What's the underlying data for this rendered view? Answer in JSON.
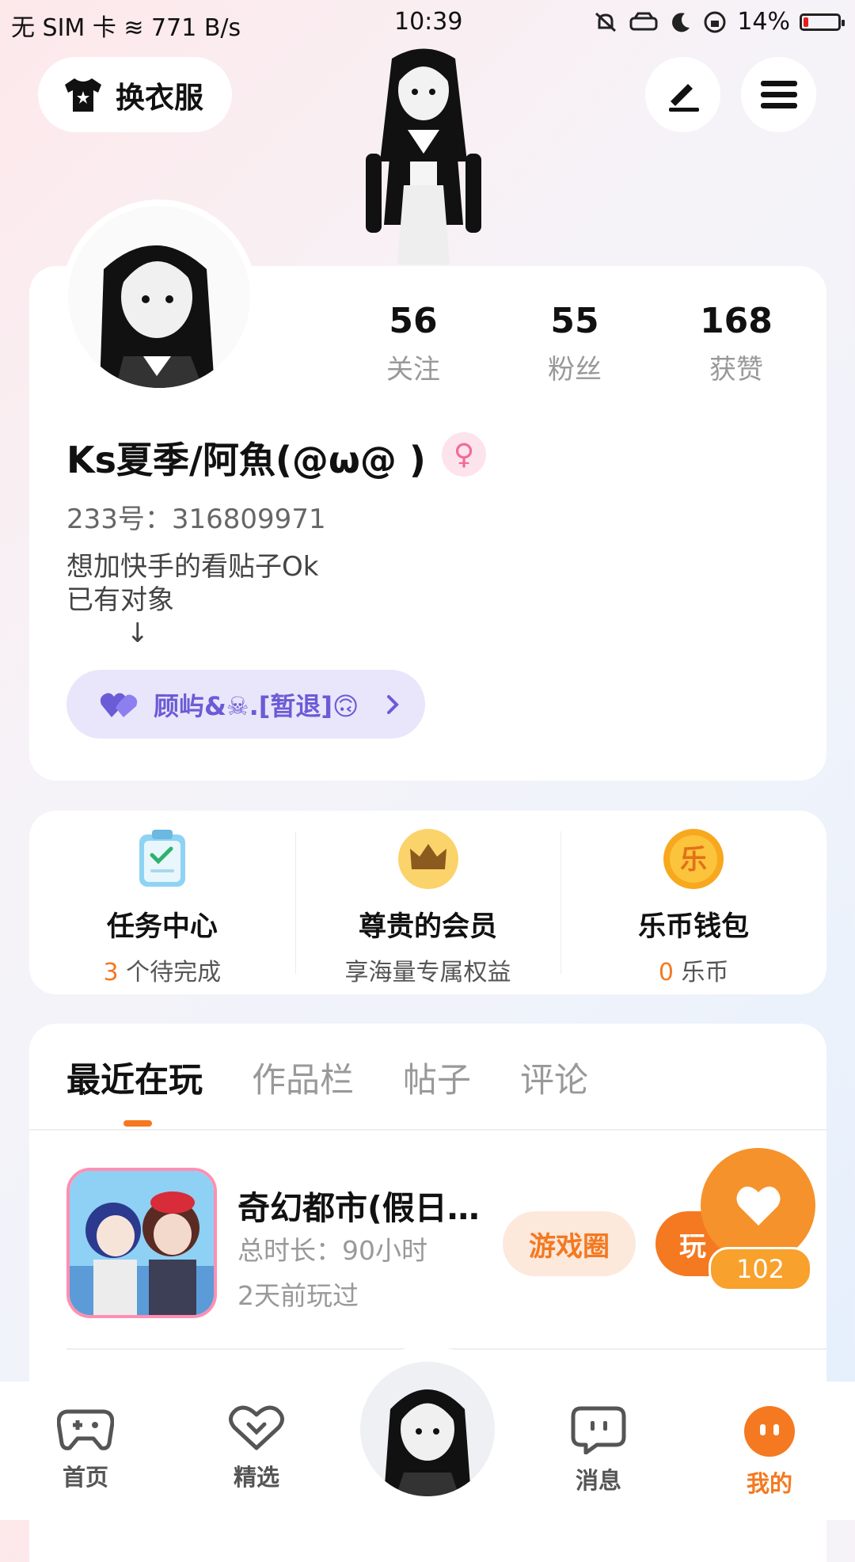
{
  "status": {
    "left": "无 SIM 卡 ≋ 771 B/s",
    "time": "10:39",
    "battery": "14%",
    "battery_level": 0.14
  },
  "header": {
    "outfit_label": "换衣服"
  },
  "profile": {
    "stats": [
      {
        "num": "56",
        "label": "关注"
      },
      {
        "num": "55",
        "label": "粉丝"
      },
      {
        "num": "168",
        "label": "获赞"
      }
    ],
    "name": "Ks夏季/阿魚(@ω@ )",
    "gender_symbol": "♀",
    "id_line": "233号：316809971",
    "bio": "想加快手的看贴子Ok\n已有对象\n       ↓",
    "couple_label": "顾屿&☠.[暂退]🙃"
  },
  "quick": [
    {
      "title": "任务中心",
      "hl": "3",
      "sub": " 个待完成"
    },
    {
      "title": "尊贵的会员",
      "hl": "",
      "sub": "享海量专属权益"
    },
    {
      "title": "乐币钱包",
      "hl": "0",
      "sub": " 乐币"
    }
  ],
  "tabs": [
    "最近在玩",
    "作品栏",
    "帖子",
    "评论"
  ],
  "game": {
    "title": "奇幻都市(假日…",
    "duration": "总时长：90小时",
    "last_played": "2天前玩过",
    "circle_label": "游戏圈",
    "play_label": "玩",
    "like_count": "102"
  },
  "nav": [
    {
      "label": "首页"
    },
    {
      "label": "精选"
    },
    {
      "label": "消息"
    },
    {
      "label": "我的"
    }
  ],
  "colors": {
    "accent": "#f47920",
    "couple": "#6b5bd6"
  }
}
